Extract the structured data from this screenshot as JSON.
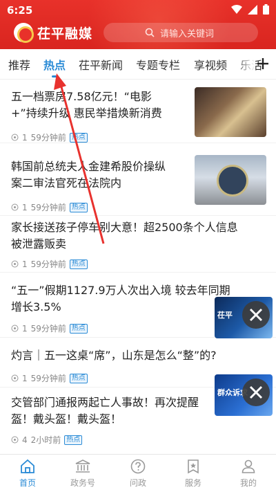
{
  "status_bar": {
    "time": "6:25"
  },
  "header": {
    "logo_text": "茌平融媒",
    "search_placeholder": "请输入关键词"
  },
  "tabs": [
    {
      "label": "推荐"
    },
    {
      "label": "热点"
    },
    {
      "label": "茌平新闻"
    },
    {
      "label": "专题专栏"
    },
    {
      "label": "享视频"
    },
    {
      "label": "乐活"
    }
  ],
  "feed": [
    {
      "title_line1": "五一档票房7.58亿元！“电影",
      "title_line2": "+”持续升级  惠民举措焕新消费",
      "count": "1",
      "time": "59分钟前",
      "tag": "热点"
    },
    {
      "title_line1": "韩国前总统夫人金建希股价操纵",
      "title_line2": "案二审法官死在法院内",
      "count": "1",
      "time": "59分钟前",
      "tag": "热点"
    },
    {
      "title_line1": "家长接送孩子停车别大意！超2500条个人信息",
      "title_line2": "被泄露贩卖",
      "count": "1",
      "time": "59分钟前",
      "tag": "热点"
    },
    {
      "title_line1": "“五一”假期1127.9万人次出入境  较去年同期",
      "title_line2": "增长3.5%",
      "count": "1",
      "time": "59分钟前",
      "tag": "热点"
    },
    {
      "title_line1": "灼言｜五一这桌“席”，山东是怎么“整”的?",
      "title_line2": "",
      "count": "1",
      "time": "59分钟前",
      "tag": "热点"
    },
    {
      "title_line1": "交管部门通报两起亡人事故！再次提醒",
      "title_line2": "盔！戴头盔！戴头盔！",
      "count": "4",
      "time": "2小时前",
      "tag": "热点"
    }
  ],
  "floating_videos": [
    {
      "label": "茌平"
    },
    {
      "label": "群众诉求"
    }
  ],
  "bottom_nav": [
    {
      "label": "首页",
      "icon": "home-icon"
    },
    {
      "label": "政务号",
      "icon": "government-icon"
    },
    {
      "label": "问政",
      "icon": "question-icon"
    },
    {
      "label": "服务",
      "icon": "service-icon"
    },
    {
      "label": "我的",
      "icon": "profile-icon"
    }
  ],
  "colors": {
    "header_red": "#e8312a",
    "accent_blue": "#2a8bd6",
    "arrow_red": "#e8322e"
  }
}
